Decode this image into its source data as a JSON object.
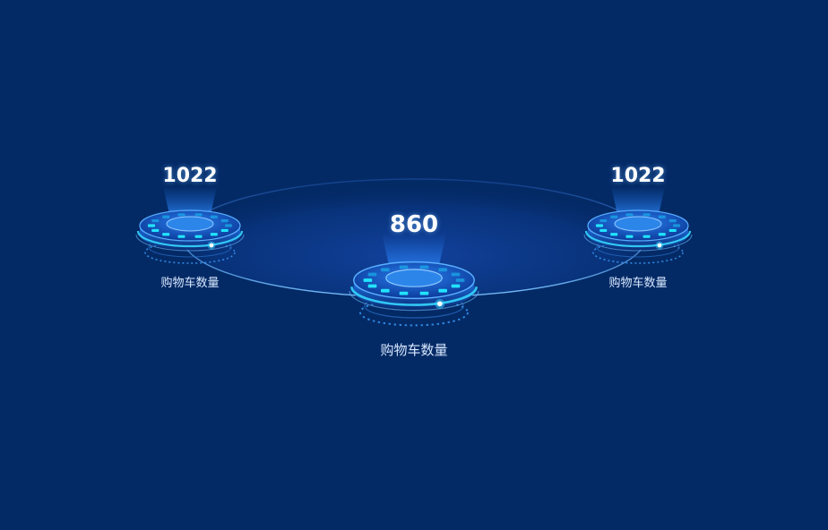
{
  "colors": {
    "background": "#042a66",
    "ring_glow": "#35d6ff",
    "disc_blue": "#1f7ee6",
    "beam": "#1d6fe0"
  },
  "stats": [
    {
      "value": "1022",
      "label": "购物车数量"
    },
    {
      "value": "860",
      "label": "购物车数量"
    },
    {
      "value": "1022",
      "label": "购物车数量"
    }
  ]
}
